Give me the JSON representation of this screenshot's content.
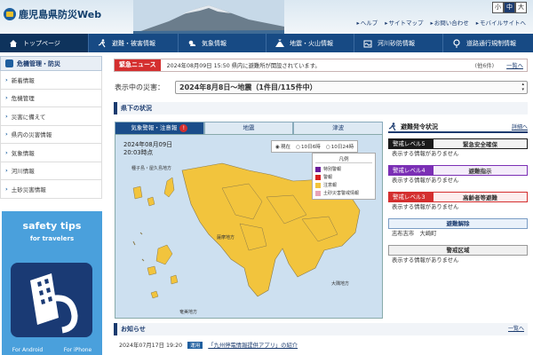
{
  "site": {
    "title": "鹿児島県防災Web"
  },
  "font_size": {
    "small": "小",
    "medium": "中",
    "large": "大"
  },
  "top_links": [
    "ヘルプ",
    "サイトマップ",
    "お問い合わせ",
    "モバイルサイトへ"
  ],
  "nav": [
    "トップページ",
    "避難・被害情報",
    "気象情報",
    "地震・火山情報",
    "河川砂防情報",
    "道路通行規制情報"
  ],
  "sidebar": {
    "heading": "危機管理・防災",
    "items": [
      "新着情報",
      "危機管理",
      "災害に備えて",
      "県内の災害情報",
      "気象情報",
      "河川情報",
      "土砂災害情報"
    ]
  },
  "banner": {
    "title": "safety tips",
    "subtitle": "for travelers",
    "android": "For Android",
    "iphone": "For iPhone"
  },
  "emergency": {
    "tag": "緊急ニュース",
    "text": "2024年08月09日 15:50 県内に避難所が開設されています。",
    "count": "(他6件)",
    "more": "一覧へ"
  },
  "disaster": {
    "label": "表示中の災害：",
    "selected": "2024年8月8日〜地震（1件目/115件中）"
  },
  "status_heading": "県下の状況",
  "map_tabs": [
    "気象警報・注意報",
    "地震",
    "津波"
  ],
  "map": {
    "date": "2024年08月09日",
    "time": "20:03時点",
    "time_options": [
      "現在",
      "10日6時",
      "10日24時"
    ],
    "legend_title": "凡例",
    "legend": [
      {
        "label": "特別警報",
        "color": "#6b1b9a"
      },
      {
        "label": "警報",
        "color": "#d62020"
      },
      {
        "label": "注意報",
        "color": "#f2c43d"
      },
      {
        "label": "土砂災害警戒情報",
        "color": "#e8a3b8"
      }
    ],
    "labels": {
      "north": "種子島・屋久島地方",
      "satsuma": "薩摩地方",
      "osumi": "大隅地方",
      "amami": "奄美地方"
    }
  },
  "evacuation": {
    "heading": "避難発令状況",
    "more": "詳細へ",
    "levels": [
      {
        "tag": "警戒レベル5",
        "name": "緊急安全確保",
        "note": "表示する情報がありません",
        "color": "#1a1a1a"
      },
      {
        "tag": "警戒レベル4",
        "name": "避難指示",
        "note": "表示する情報がありません",
        "color": "#7b2fb5"
      },
      {
        "tag": "警戒レベル3",
        "name": "高齢者等避難",
        "note": "表示する情報がありません",
        "color": "#d42f2f"
      }
    ],
    "lift": {
      "name": "避難解除",
      "note": "志布志市　大崎町"
    },
    "zone": {
      "name": "警戒区域",
      "note": "表示する情報がありません"
    }
  },
  "news": {
    "heading": "お知らせ",
    "more": "一覧へ",
    "date": "2024年07月17日 19:20",
    "badge": "運用",
    "link": "「九州停電情報提供アプリ」の紹介"
  }
}
